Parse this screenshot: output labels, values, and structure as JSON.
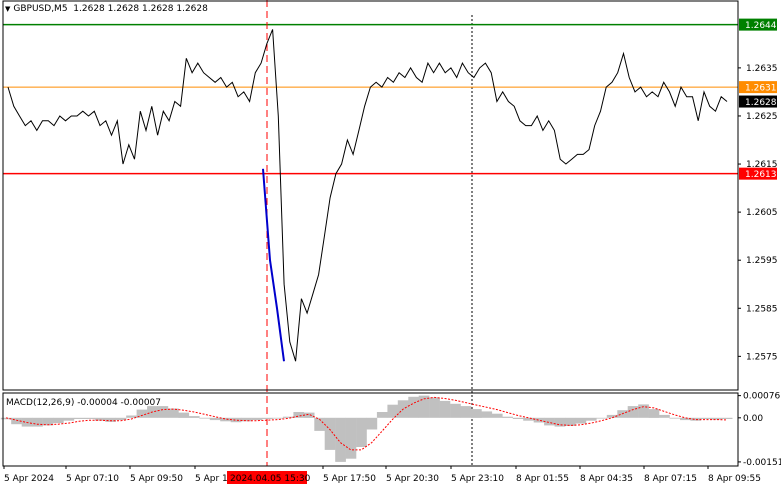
{
  "header": {
    "symbol": "GBPUSD,M5",
    "ohlc": "1.2628 1.2628 1.2628 1.2628"
  },
  "colors": {
    "price_line": "#000000",
    "resistance": "#008000",
    "support": "#ff0000",
    "pivot": "#ff8c00",
    "drop_line": "#0000cc",
    "event_line": "#ff0000",
    "macd_hist": "#c0c0c0",
    "macd_signal": "#ff0000",
    "current_tag": "#000000"
  },
  "chart_data": [
    {
      "type": "line",
      "title": "GBPUSD,M5",
      "ylim": [
        1.2568,
        1.2646
      ],
      "y_ticks": [
        "1.2575",
        "1.2585",
        "1.2595",
        "1.2605",
        "1.2615",
        "1.2625",
        "1.2635"
      ],
      "x_ticks": [
        "5 Apr 2024",
        "5 Apr 07:10",
        "5 Apr 09:50",
        "5 Apr 1",
        "5 Apr 17:50",
        "5 Apr 20:30",
        "5 Apr 23:10",
        "8 Apr 01:55",
        "8 Apr 04:35",
        "8 Apr 07:15",
        "8 Apr 09:55"
      ],
      "event_label": "2024.04.05 15:30",
      "levels": [
        {
          "label": "1.2644",
          "value": 1.2644,
          "color": "#008000"
        },
        {
          "label": "1.2631",
          "value": 1.2631,
          "color": "#ff8c00"
        },
        {
          "label": "1.2613",
          "value": 1.2613,
          "color": "#ff0000"
        }
      ],
      "current_price": "1.2628",
      "series": [
        {
          "values": [
            1.2631,
            1.2627,
            1.2625,
            1.2623,
            1.2624,
            1.2622,
            1.2624,
            1.2624,
            1.2623,
            1.2625,
            1.2624,
            1.2625,
            1.2625,
            1.2626,
            1.2625,
            1.2626,
            1.2623,
            1.2624,
            1.2621,
            1.2624,
            1.2615,
            1.2619,
            1.2616,
            1.2626,
            1.2622,
            1.2627,
            1.2621,
            1.2626,
            1.2624,
            1.2628,
            1.2627,
            1.2637,
            1.2634,
            1.2636,
            1.2634,
            1.2633,
            1.2632,
            1.2633,
            1.2631,
            1.2632,
            1.2629,
            1.263,
            1.2628,
            1.2634,
            1.2636,
            1.264,
            1.2643,
            1.2625,
            1.259,
            1.2578,
            1.2574,
            1.2587,
            1.2584,
            1.2588,
            1.2592,
            1.26,
            1.2608,
            1.2613,
            1.2615,
            1.262,
            1.2617,
            1.2622,
            1.2627,
            1.2631,
            1.2632,
            1.2631,
            1.2633,
            1.2632,
            1.2634,
            1.2633,
            1.2635,
            1.2633,
            1.2632,
            1.2636,
            1.2634,
            1.2636,
            1.2634,
            1.2635,
            1.2633,
            1.2636,
            1.2634,
            1.2633,
            1.2635,
            1.2636,
            1.2634,
            1.2628,
            1.263,
            1.2628,
            1.2627,
            1.2624,
            1.2623,
            1.2623,
            1.2625,
            1.2622,
            1.2624,
            1.2622,
            1.2616,
            1.2615,
            1.2616,
            1.2617,
            1.2617,
            1.2618,
            1.2623,
            1.2626,
            1.2631,
            1.2632,
            1.2634,
            1.2638,
            1.2633,
            1.263,
            1.2631,
            1.2629,
            1.263,
            1.2629,
            1.2632,
            1.263,
            1.2627,
            1.2631,
            1.2629,
            1.2629,
            1.2624,
            1.263,
            1.2627,
            1.2626,
            1.2629,
            1.2628
          ]
        },
        {
          "name": "",
          "values": [
            1.2614,
            1.2595,
            1.2585,
            1.2574
          ]
        }
      ]
    },
    {
      "type": "bar",
      "title": "MACD(12,26,9) -0.00004 -0.00007",
      "ylim": [
        -0.00165,
        0.00085
      ],
      "y_ticks": [
        "0.00076",
        "0.00",
        "-0.00151"
      ],
      "series": [
        {
          "name": "MACD",
          "values": [
            -5e-05,
            -0.00022,
            -0.0003,
            -0.0003,
            -0.00026,
            -0.00018,
            -0.0001,
            -4e-05,
            -4e-05,
            -0.0001,
            -0.00014,
            -8e-05,
            8e-05,
            0.00028,
            0.0004,
            0.0004,
            0.00032,
            0.00018,
            6e-05,
            0.0,
            -8e-05,
            -0.00012,
            -0.00015,
            -0.00012,
            -8e-05,
            -4e-05,
            -2e-05,
            4e-05,
            0.0002,
            0.00018,
            -0.00045,
            -0.0011,
            -0.00151,
            -0.0014,
            -0.001,
            -0.0004,
            0.0002,
            0.00045,
            0.0006,
            0.00072,
            0.00076,
            0.0007,
            0.00058,
            0.00048,
            0.0004,
            0.0003,
            0.00022,
            0.00014,
            4e-05,
            -4e-05,
            -0.0001,
            -0.00016,
            -0.00026,
            -0.0003,
            -0.00028,
            -0.0002,
            -0.0001,
            -2e-05,
            0.0001,
            0.00026,
            0.0004,
            0.00046,
            0.0003,
            0.0001,
            0.0,
            -8e-05,
            -0.0001,
            -4e-05,
            -6e-05,
            -4e-05
          ]
        },
        {
          "name": "Signal",
          "values": [
            0.0,
            -8e-05,
            -0.00016,
            -0.00022,
            -0.00024,
            -0.00022,
            -0.00018,
            -0.00012,
            -8e-05,
            -8e-05,
            -0.0001,
            -0.0001,
            -4e-05,
            8e-05,
            0.0002,
            0.00028,
            0.0003,
            0.00026,
            0.0002,
            0.00012,
            4e-05,
            -4e-05,
            -8e-05,
            -0.0001,
            -0.0001,
            -8e-05,
            -6e-05,
            -2e-05,
            6e-05,
            0.00012,
            -5e-05,
            -0.0004,
            -0.00085,
            -0.0011,
            -0.0011,
            -0.00085,
            -0.00045,
            -5e-05,
            0.0003,
            0.0005,
            0.00065,
            0.0007,
            0.00066,
            0.0006,
            0.00052,
            0.00044,
            0.00036,
            0.00028,
            0.00018,
            8e-05,
            0.0,
            -8e-05,
            -0.00016,
            -0.00024,
            -0.00026,
            -0.00024,
            -0.00018,
            -0.0001,
            0.0,
            0.00014,
            0.00028,
            0.00038,
            0.00034,
            0.00022,
            0.0001,
            0.0,
            -6e-05,
            -6e-05,
            -6e-05,
            -7e-05
          ]
        }
      ]
    }
  ]
}
